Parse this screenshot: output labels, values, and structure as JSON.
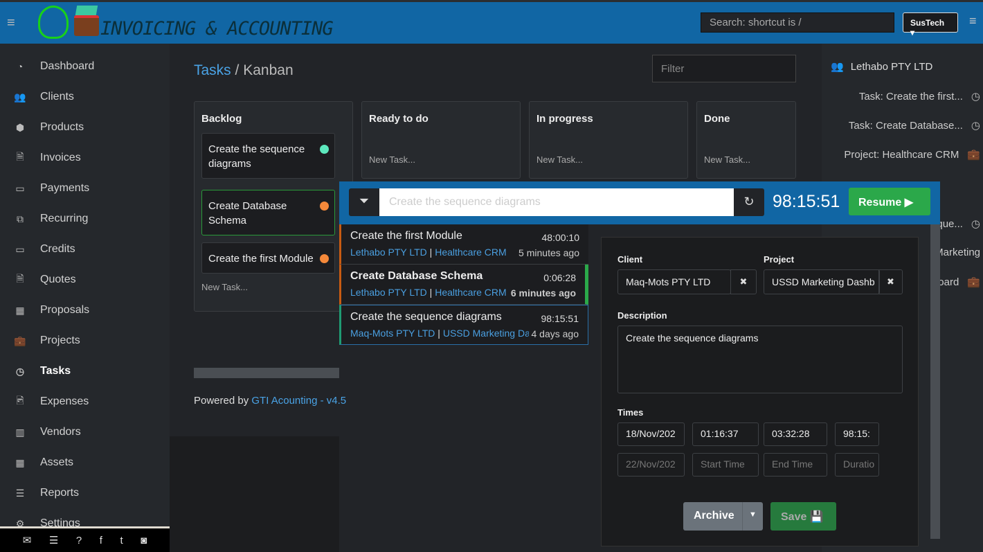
{
  "header": {
    "brand": "INVOICING & ACCOUNTING",
    "search_placeholder": "Search: shortcut is /",
    "org": "SusTech ▾"
  },
  "sidebar": {
    "items": [
      {
        "label": "Dashboard",
        "icon": "dashboard-icon",
        "glyph": "◔"
      },
      {
        "label": "Clients",
        "icon": "users-icon",
        "glyph": "👥"
      },
      {
        "label": "Products",
        "icon": "cube-icon",
        "glyph": "⬢"
      },
      {
        "label": "Invoices",
        "icon": "file-pdf-icon",
        "glyph": "🗎"
      },
      {
        "label": "Payments",
        "icon": "credit-card-icon",
        "glyph": "▭"
      },
      {
        "label": "Recurring",
        "icon": "clone-icon",
        "glyph": "⧉"
      },
      {
        "label": "Credits",
        "icon": "credit-card-icon",
        "glyph": "▭"
      },
      {
        "label": "Quotes",
        "icon": "file-text-icon",
        "glyph": "🗎"
      },
      {
        "label": "Proposals",
        "icon": "th-large-icon",
        "glyph": "▦"
      },
      {
        "label": "Projects",
        "icon": "briefcase-icon",
        "glyph": "💼"
      },
      {
        "label": "Tasks",
        "icon": "clock-icon",
        "glyph": "◷",
        "active": true
      },
      {
        "label": "Expenses",
        "icon": "image-icon",
        "glyph": "🖻"
      },
      {
        "label": "Vendors",
        "icon": "building-icon",
        "glyph": "▥"
      },
      {
        "label": "Assets",
        "icon": "th-large-icon",
        "glyph": "▦"
      },
      {
        "label": "Reports",
        "icon": "list-icon",
        "glyph": "☰"
      },
      {
        "label": "Settings",
        "icon": "gear-icon",
        "glyph": "⚙"
      }
    ],
    "footer_icons": [
      {
        "icon": "envelope-icon",
        "glyph": "✉"
      },
      {
        "icon": "list-icon",
        "glyph": "☰"
      },
      {
        "icon": "question-icon",
        "glyph": "?"
      },
      {
        "icon": "facebook-icon",
        "glyph": "f"
      },
      {
        "icon": "twitter-icon",
        "glyph": "t"
      },
      {
        "icon": "github-icon",
        "glyph": "◙"
      }
    ]
  },
  "breadcrumb": {
    "parent": "Tasks",
    "sep": "/",
    "current": "Kanban"
  },
  "filter_placeholder": "Filter",
  "kanban": {
    "new_task": "New Task...",
    "columns": [
      {
        "title": "Backlog",
        "cards": [
          {
            "text": "Create the sequence diagrams",
            "color": "#5de8bd"
          },
          {
            "text": "Create Database Schema",
            "color": "#f5893a"
          },
          {
            "text": "Create the first Module",
            "color": "#f5893a"
          }
        ]
      },
      {
        "title": "Ready to do"
      },
      {
        "title": "In progress"
      },
      {
        "title": "Done"
      }
    ]
  },
  "right_panel": {
    "client": "Lethabo PTY LTD",
    "items": [
      {
        "label": "Task: Create the first...",
        "icon": "clock-icon",
        "glyph": "◷"
      },
      {
        "label": "Task: Create Database...",
        "icon": "clock-icon",
        "glyph": "◷"
      },
      {
        "label": "Project: Healthcare CRM",
        "icon": "briefcase-icon",
        "glyph": "💼"
      },
      {
        "label": "que...",
        "icon": "clock-icon",
        "glyph": "◷"
      },
      {
        "label": "Marketing",
        "icon": "",
        "glyph": ""
      },
      {
        "label": "board",
        "icon": "briefcase-icon",
        "glyph": "💼"
      }
    ]
  },
  "timer": {
    "input_placeholder": "Create the sequence diagrams",
    "clock": "98:15:51",
    "resume": "Resume ▶"
  },
  "task_list": [
    {
      "title": "Create the first Module",
      "time": "48:00:10",
      "client": "Lethabo PTY LTD",
      "project": "Healthcare CRM",
      "ago": "5 minutes ago",
      "color": "#c75b12"
    },
    {
      "title": "Create Database Schema",
      "time": "0:06:28",
      "client": "Lethabo PTY LTD",
      "project": "Healthcare CRM",
      "ago": "6 minutes ago",
      "color": "#c75b12",
      "bold": true
    },
    {
      "title": "Create the sequence diagrams",
      "time": "98:15:51",
      "client": "Maq-Mots PTY LTD",
      "project": "USSD Marketing Dashboard",
      "ago": "4 days ago",
      "color": "#1f9a72"
    }
  ],
  "editor": {
    "client_label": "Client",
    "client": "Maq-Mots PTY LTD",
    "project_label": "Project",
    "project": "USSD Marketing Dashb",
    "description_label": "Description",
    "description": "Create the sequence diagrams",
    "times_label": "Times",
    "row1": [
      "18/Nov/202",
      "01:16:37",
      "03:32:28",
      "98:15:"
    ],
    "row2": [
      "22/Nov/202",
      "Start Time",
      "End Time",
      "Duratio"
    ],
    "archive": "Archive",
    "save": "Save 💾"
  },
  "powered": {
    "prefix": "Powered by ",
    "link": "GTI Acounting - v4.5"
  }
}
